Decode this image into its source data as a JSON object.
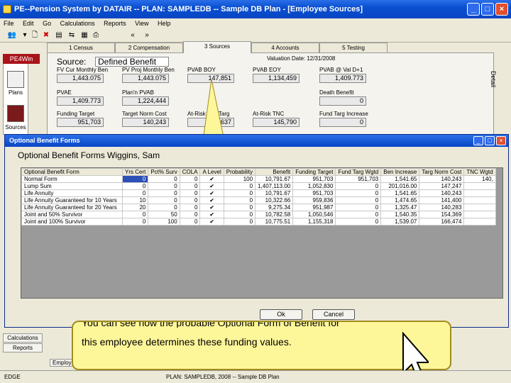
{
  "window": {
    "title": "PE--Pension System by DATAIR -- PLAN: SAMPLEDB -- Sample DB Plan - [Employee Sources]"
  },
  "menu": [
    "File",
    "Edit",
    "Go",
    "Calculations",
    "Reports",
    "View",
    "Help"
  ],
  "tabs": [
    "1 Census",
    "2 Compensation",
    "3 Sources",
    "4 Accounts",
    "5 Testing"
  ],
  "sidebar": {
    "header": "PE4Win",
    "items": [
      "Plans",
      "Sources"
    ],
    "bottom": [
      "Calculations",
      "Reports"
    ]
  },
  "source": {
    "label": "Source:",
    "value": "Defined Benefit",
    "valuation_date": "Valuation Date: 12/31/2008",
    "fields": [
      {
        "label": "FV Cur Monthly Ben",
        "value": "1,443.075"
      },
      {
        "label": "PV Proj Monthly Ben",
        "value": "1,443.075"
      },
      {
        "label": "PVAB BOY",
        "value": "147,851"
      },
      {
        "label": "PVAB EOY",
        "value": "1,134,459"
      },
      {
        "label": "PVAB @ Val D+1",
        "value": "1,409.773"
      },
      {
        "label": "PVAE",
        "value": "1,409.773"
      },
      {
        "label": "Plan'n PVAB",
        "value": "1,224,444"
      },
      {
        "label": "Death Benefit",
        "value": "0"
      },
      {
        "label": "Funding Target",
        "value": "951,703"
      },
      {
        "label": "Target Norm Cost",
        "value": "140,243"
      },
      {
        "label": "At-Risk Fnd Targ",
        "value": "637"
      },
      {
        "label": "At-Risk TNC",
        "value": "145,790"
      },
      {
        "label": "Fund Targ Increase",
        "value": "0"
      }
    ],
    "detail": "Detail"
  },
  "dialog": {
    "title": "Optional Benefit Forms",
    "subtitle": "Optional Benefit Forms Wiggins, Sam",
    "columns": [
      "Optional Benefit Form",
      "Yrs Cert",
      "Pct% Surv",
      "COLA",
      "A Level",
      "Probability",
      "Benefit",
      "Funding Target",
      "Fund Targ Wgtd",
      "Ben Increase",
      "Targ Norm Cost",
      "TNC Wgtd"
    ],
    "rows": [
      [
        "Normal Form",
        "0",
        "0",
        "0",
        "✔",
        "100",
        "10,791.67",
        "951,703",
        "951,703",
        "1,541.65",
        "140,243",
        "140,"
      ],
      [
        "Lump Sum",
        "0",
        "0",
        "0",
        "✔",
        "0",
        "1,407,113.00",
        "1,052,830",
        "0",
        "201,016.00",
        "147,247",
        ""
      ],
      [
        "Life Annuity",
        "0",
        "0",
        "0",
        "✔",
        "0",
        "10,791.67",
        "951,703",
        "0",
        "1,541.65",
        "140,243",
        ""
      ],
      [
        "Life Annuity Guaranteed for 10 Years",
        "10",
        "0",
        "0",
        "✔",
        "0",
        "10,322.66",
        "959,836",
        "0",
        "1,474.65",
        "141,400",
        ""
      ],
      [
        "Life Annuity Guaranteed for 20 Years",
        "20",
        "0",
        "0",
        "✔",
        "0",
        "9,275.34",
        "951,987",
        "0",
        "1,325.47",
        "140,283",
        ""
      ],
      [
        "Joint and 50% Survivor",
        "0",
        "50",
        "0",
        "✔",
        "0",
        "10,782.58",
        "1,050,546",
        "0",
        "1,540.35",
        "154,369",
        ""
      ],
      [
        "Joint and 100% Survivor",
        "0",
        "100",
        "0",
        "✔",
        "0",
        "10,775.51",
        "1,155,318",
        "0",
        "1,539.07",
        "166,474",
        ""
      ]
    ],
    "ok": "Ok",
    "cancel": "Cancel"
  },
  "callout": {
    "line1": "You can see how the probable Optional Form of Benefit for",
    "line2": "this employee determines these funding values."
  },
  "status": {
    "left": "EDGE",
    "center": "PLAN: SAMPLEDB, 2008 -- Sample DB Plan",
    "tab": "Employ"
  },
  "colors": {
    "titlebar": "#0a4fd0",
    "selection": "#2c4fb8",
    "callout": "#fef79a"
  }
}
